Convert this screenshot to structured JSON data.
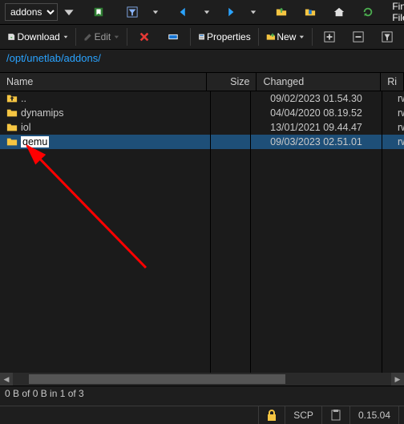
{
  "toolbar1": {
    "address_value": "addons",
    "find_files": "Find Files"
  },
  "toolbar2": {
    "download": "Download",
    "edit": "Edit",
    "properties": "Properties",
    "new": "New"
  },
  "path": "/opt/unetlab/addons/",
  "columns": {
    "name": "Name",
    "size": "Size",
    "changed": "Changed",
    "rights": "Ri"
  },
  "rows": [
    {
      "name": "..",
      "icon": "up",
      "size": "",
      "changed": "09/02/2023 01.54.30",
      "rights": "rw",
      "selected": false
    },
    {
      "name": "dynamips",
      "icon": "folder",
      "size": "",
      "changed": "04/04/2020 08.19.52",
      "rights": "rw",
      "selected": false
    },
    {
      "name": "iol",
      "icon": "folder",
      "size": "",
      "changed": "13/01/2021 09.44.47",
      "rights": "rw",
      "selected": false
    },
    {
      "name": "qemu",
      "icon": "folder",
      "size": "",
      "changed": "09/03/2023 02.51.01",
      "rights": "rw",
      "selected": true
    }
  ],
  "status1": "0 B of 0 B in 1 of 3",
  "status2": {
    "protocol": "SCP",
    "elapsed": "0.15.04"
  }
}
